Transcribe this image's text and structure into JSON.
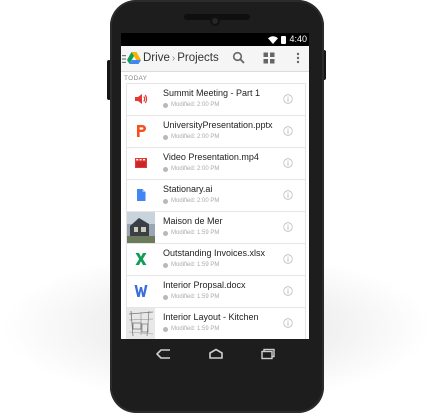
{
  "status_bar": {
    "time": "4:40"
  },
  "action_bar": {
    "app_name": "Drive",
    "separator": "›",
    "folder": "Projects"
  },
  "section": {
    "label": "TODAY"
  },
  "files": [
    {
      "name": "Summit Meeting - Part 1",
      "modified": "Modified: 2:00 PM",
      "icon": "audio-icon"
    },
    {
      "name": "UniversityPresentation.pptx",
      "modified": "Modified: 2:00 PM",
      "icon": "slides-icon"
    },
    {
      "name": "Video Presentation.mp4",
      "modified": "Modified: 2:00 PM",
      "icon": "video-icon"
    },
    {
      "name": "Stationary.ai",
      "modified": "Modified: 2:00 PM",
      "icon": "document-icon"
    },
    {
      "name": "Maison de Mer",
      "modified": "Modified: 1:59 PM",
      "icon": "image-thumbnail"
    },
    {
      "name": "Outstanding Invoices.xlsx",
      "modified": "Modified: 1:59 PM",
      "icon": "spreadsheet-icon"
    },
    {
      "name": "Interior Propsal.docx",
      "modified": "Modified: 1:59 PM",
      "icon": "word-doc-icon"
    },
    {
      "name": "Interior Layout - Kitchen",
      "modified": "Modified: 1:59 PM",
      "icon": "sketch-thumbnail"
    }
  ],
  "colors": {
    "audio": "#e53935",
    "slides": "#f4511e",
    "video": "#e53935",
    "doc": "#4285f4",
    "sheet": "#0f9d58",
    "word": "#3b6fd8"
  }
}
